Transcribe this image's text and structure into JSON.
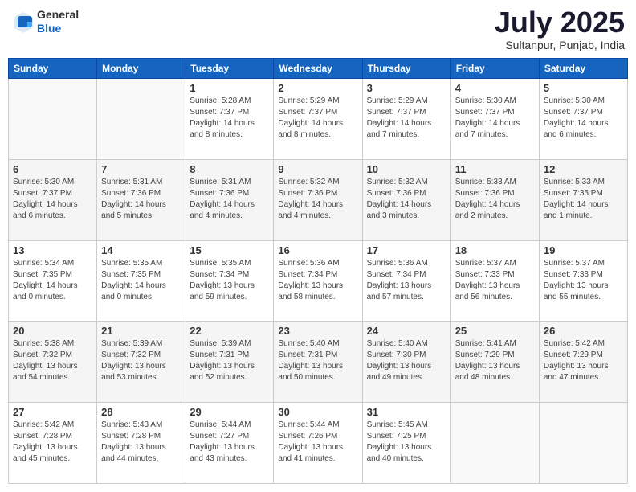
{
  "header": {
    "logo": {
      "general": "General",
      "blue": "Blue"
    },
    "title": "July 2025",
    "location": "Sultanpur, Punjab, India"
  },
  "calendar": {
    "days_of_week": [
      "Sunday",
      "Monday",
      "Tuesday",
      "Wednesday",
      "Thursday",
      "Friday",
      "Saturday"
    ],
    "weeks": [
      [
        {
          "day": "",
          "info": ""
        },
        {
          "day": "",
          "info": ""
        },
        {
          "day": "1",
          "info": "Sunrise: 5:28 AM\nSunset: 7:37 PM\nDaylight: 14 hours\nand 8 minutes."
        },
        {
          "day": "2",
          "info": "Sunrise: 5:29 AM\nSunset: 7:37 PM\nDaylight: 14 hours\nand 8 minutes."
        },
        {
          "day": "3",
          "info": "Sunrise: 5:29 AM\nSunset: 7:37 PM\nDaylight: 14 hours\nand 7 minutes."
        },
        {
          "day": "4",
          "info": "Sunrise: 5:30 AM\nSunset: 7:37 PM\nDaylight: 14 hours\nand 7 minutes."
        },
        {
          "day": "5",
          "info": "Sunrise: 5:30 AM\nSunset: 7:37 PM\nDaylight: 14 hours\nand 6 minutes."
        }
      ],
      [
        {
          "day": "6",
          "info": "Sunrise: 5:30 AM\nSunset: 7:37 PM\nDaylight: 14 hours\nand 6 minutes."
        },
        {
          "day": "7",
          "info": "Sunrise: 5:31 AM\nSunset: 7:36 PM\nDaylight: 14 hours\nand 5 minutes."
        },
        {
          "day": "8",
          "info": "Sunrise: 5:31 AM\nSunset: 7:36 PM\nDaylight: 14 hours\nand 4 minutes."
        },
        {
          "day": "9",
          "info": "Sunrise: 5:32 AM\nSunset: 7:36 PM\nDaylight: 14 hours\nand 4 minutes."
        },
        {
          "day": "10",
          "info": "Sunrise: 5:32 AM\nSunset: 7:36 PM\nDaylight: 14 hours\nand 3 minutes."
        },
        {
          "day": "11",
          "info": "Sunrise: 5:33 AM\nSunset: 7:36 PM\nDaylight: 14 hours\nand 2 minutes."
        },
        {
          "day": "12",
          "info": "Sunrise: 5:33 AM\nSunset: 7:35 PM\nDaylight: 14 hours\nand 1 minute."
        }
      ],
      [
        {
          "day": "13",
          "info": "Sunrise: 5:34 AM\nSunset: 7:35 PM\nDaylight: 14 hours\nand 0 minutes."
        },
        {
          "day": "14",
          "info": "Sunrise: 5:35 AM\nSunset: 7:35 PM\nDaylight: 14 hours\nand 0 minutes."
        },
        {
          "day": "15",
          "info": "Sunrise: 5:35 AM\nSunset: 7:34 PM\nDaylight: 13 hours\nand 59 minutes."
        },
        {
          "day": "16",
          "info": "Sunrise: 5:36 AM\nSunset: 7:34 PM\nDaylight: 13 hours\nand 58 minutes."
        },
        {
          "day": "17",
          "info": "Sunrise: 5:36 AM\nSunset: 7:34 PM\nDaylight: 13 hours\nand 57 minutes."
        },
        {
          "day": "18",
          "info": "Sunrise: 5:37 AM\nSunset: 7:33 PM\nDaylight: 13 hours\nand 56 minutes."
        },
        {
          "day": "19",
          "info": "Sunrise: 5:37 AM\nSunset: 7:33 PM\nDaylight: 13 hours\nand 55 minutes."
        }
      ],
      [
        {
          "day": "20",
          "info": "Sunrise: 5:38 AM\nSunset: 7:32 PM\nDaylight: 13 hours\nand 54 minutes."
        },
        {
          "day": "21",
          "info": "Sunrise: 5:39 AM\nSunset: 7:32 PM\nDaylight: 13 hours\nand 53 minutes."
        },
        {
          "day": "22",
          "info": "Sunrise: 5:39 AM\nSunset: 7:31 PM\nDaylight: 13 hours\nand 52 minutes."
        },
        {
          "day": "23",
          "info": "Sunrise: 5:40 AM\nSunset: 7:31 PM\nDaylight: 13 hours\nand 50 minutes."
        },
        {
          "day": "24",
          "info": "Sunrise: 5:40 AM\nSunset: 7:30 PM\nDaylight: 13 hours\nand 49 minutes."
        },
        {
          "day": "25",
          "info": "Sunrise: 5:41 AM\nSunset: 7:29 PM\nDaylight: 13 hours\nand 48 minutes."
        },
        {
          "day": "26",
          "info": "Sunrise: 5:42 AM\nSunset: 7:29 PM\nDaylight: 13 hours\nand 47 minutes."
        }
      ],
      [
        {
          "day": "27",
          "info": "Sunrise: 5:42 AM\nSunset: 7:28 PM\nDaylight: 13 hours\nand 45 minutes."
        },
        {
          "day": "28",
          "info": "Sunrise: 5:43 AM\nSunset: 7:28 PM\nDaylight: 13 hours\nand 44 minutes."
        },
        {
          "day": "29",
          "info": "Sunrise: 5:44 AM\nSunset: 7:27 PM\nDaylight: 13 hours\nand 43 minutes."
        },
        {
          "day": "30",
          "info": "Sunrise: 5:44 AM\nSunset: 7:26 PM\nDaylight: 13 hours\nand 41 minutes."
        },
        {
          "day": "31",
          "info": "Sunrise: 5:45 AM\nSunset: 7:25 PM\nDaylight: 13 hours\nand 40 minutes."
        },
        {
          "day": "",
          "info": ""
        },
        {
          "day": "",
          "info": ""
        }
      ]
    ]
  }
}
